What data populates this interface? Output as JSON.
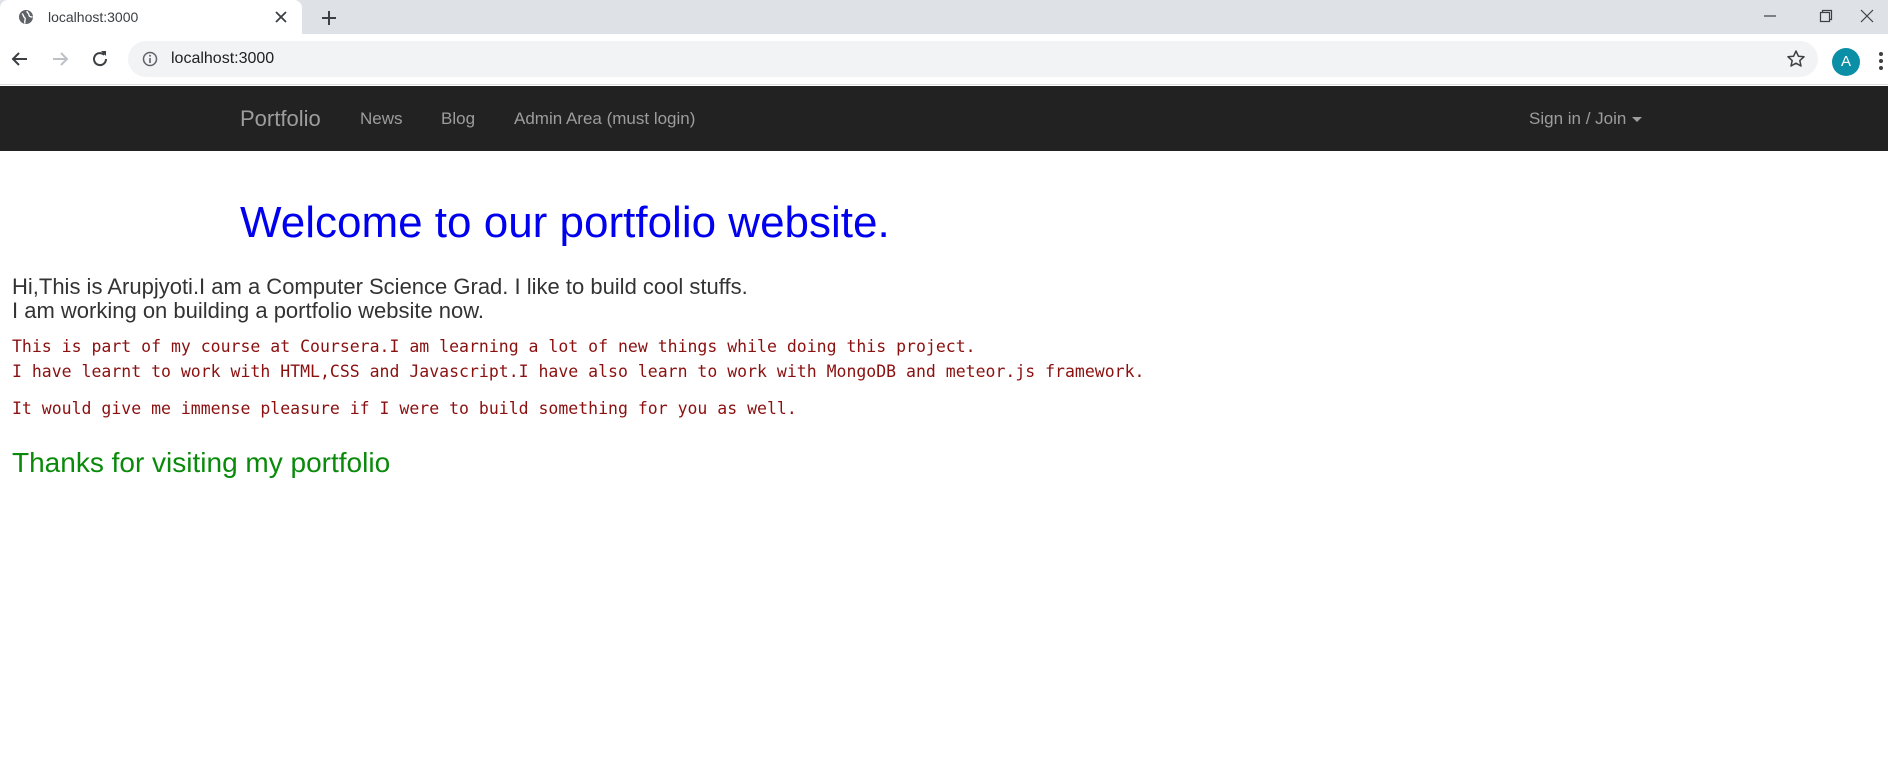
{
  "browser": {
    "tab_title": "localhost:3000",
    "address": "localhost:3000",
    "profile_initial": "A"
  },
  "navbar": {
    "brand": "Portfolio",
    "links": [
      "News",
      "Blog",
      "Admin Area (must login)"
    ],
    "signin": "Sign in / Join"
  },
  "content": {
    "heading": "Welcome to our portfolio website.",
    "intro_line1": "Hi,This is Arupjyoti.I am a Computer Science Grad. I like to build cool stuffs.",
    "intro_line2": "I am working on building a portfolio website now.",
    "course_line1": "This is part of my course at Coursera.I am learning a lot of new things while doing this project.",
    "course_line2": "I have learnt to work with HTML,CSS and Javascript.I have also learn to work with MongoDB and meteor.js framework.",
    "pleasure_line": "It would give me immense pleasure if I were to build something for you as well.",
    "thanks": "Thanks for visiting my portfolio"
  },
  "colors": {
    "navbar_bg": "#222222",
    "heading": "#0000ee",
    "mono_text": "#8b1010",
    "thanks": "#0a8a0a"
  },
  "icons": [
    "globe-icon",
    "close-icon",
    "plus-icon",
    "minimize-icon",
    "restore-icon",
    "window-close-icon",
    "back-arrow-icon",
    "forward-arrow-icon",
    "reload-icon",
    "info-icon",
    "star-icon",
    "more-vert-icon",
    "caret-down-icon"
  ]
}
